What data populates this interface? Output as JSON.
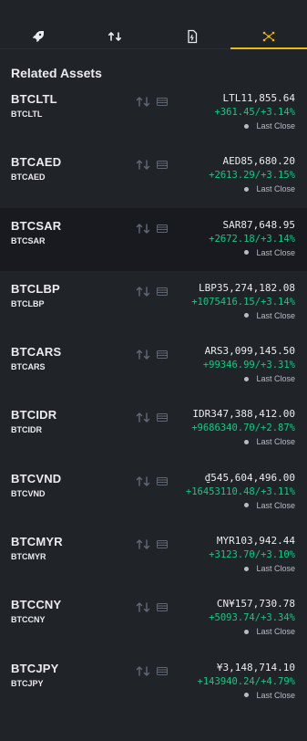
{
  "tabs": [
    {
      "icon": "rocket-icon",
      "active": false
    },
    {
      "icon": "swap-arrows-icon",
      "active": false
    },
    {
      "icon": "document-icon",
      "active": false
    },
    {
      "icon": "network-icon",
      "active": true
    }
  ],
  "section_title": "Related Assets",
  "assets": [
    {
      "symbol": "BTCLTL",
      "sub": "BTCLTL",
      "price": "LTL11,855.64",
      "change": "+361.45/+3.14%",
      "status": "Last Close"
    },
    {
      "symbol": "BTCAED",
      "sub": "BTCAED",
      "price": "AED85,680.20",
      "change": "+2613.29/+3.15%",
      "status": "Last Close"
    },
    {
      "symbol": "BTCSAR",
      "sub": "BTCSAR",
      "price": "SAR87,648.95",
      "change": "+2672.18/+3.14%",
      "status": "Last Close"
    },
    {
      "symbol": "BTCLBP",
      "sub": "BTCLBP",
      "price": "LBP35,274,182.08",
      "change": "+1075416.15/+3.14%",
      "status": "Last Close"
    },
    {
      "symbol": "BTCARS",
      "sub": "BTCARS",
      "price": "ARS3,099,145.50",
      "change": "+99346.99/+3.31%",
      "status": "Last Close"
    },
    {
      "symbol": "BTCIDR",
      "sub": "BTCIDR",
      "price": "IDR347,388,412.00",
      "change": "+9686340.70/+2.87%",
      "status": "Last Close"
    },
    {
      "symbol": "BTCVND",
      "sub": "BTCVND",
      "price": "₫545,604,496.00",
      "change": "+16453110.48/+3.11%",
      "status": "Last Close"
    },
    {
      "symbol": "BTCMYR",
      "sub": "BTCMYR",
      "price": "MYR103,942.44",
      "change": "+3123.70/+3.10%",
      "status": "Last Close"
    },
    {
      "symbol": "BTCCNY",
      "sub": "BTCCNY",
      "price": "CN¥157,730.78",
      "change": "+5093.74/+3.34%",
      "status": "Last Close"
    },
    {
      "symbol": "BTCJPY",
      "sub": "BTCJPY",
      "price": "¥3,148,714.10",
      "change": "+143940.24/+4.79%",
      "status": "Last Close"
    }
  ],
  "colors": {
    "accent": "#f0b90b",
    "positive": "#0ecb81",
    "highlight_row": "#181a1f"
  }
}
